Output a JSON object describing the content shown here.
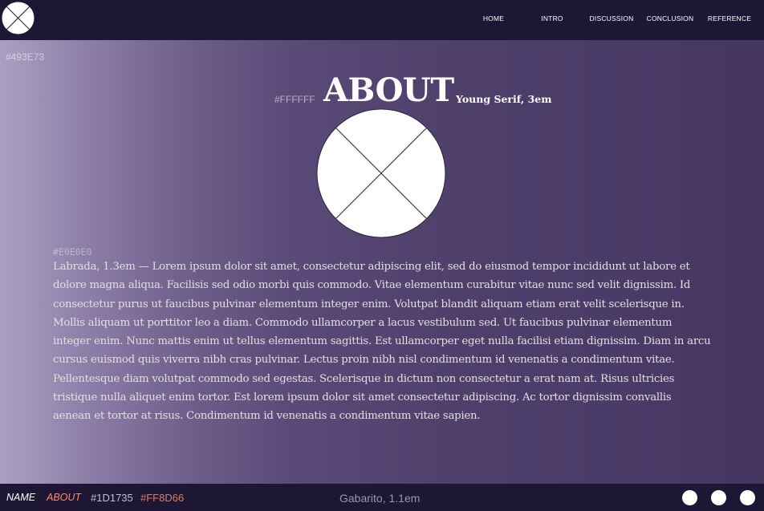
{
  "header": {
    "nav": [
      {
        "label": "HOME",
        "key": "home"
      },
      {
        "label": "INTRO",
        "key": "intro"
      },
      {
        "label": "DISCUSSION",
        "key": "discussion"
      },
      {
        "label": "CONCLUSION",
        "key": "conclusion"
      },
      {
        "label": "REFERENCE",
        "key": "reference"
      }
    ]
  },
  "main": {
    "bg_color_note": "#493E73",
    "title_color_note": "#FFFFFF",
    "title": "ABOUT",
    "title_font_note": "Young Serif, 3em",
    "body_color_note": "#E0E0E0",
    "body_text": "Labrada, 1.3em —  Lorem ipsum dolor sit amet, consectetur adipiscing elit, sed do eiusmod tempor incididunt ut labore et dolore magna aliqua. Facilisis sed odio morbi quis commodo. Vitae elementum curabitur vitae nunc sed velit dignissim. Id consectetur purus ut faucibus pulvinar elementum integer enim. Volutpat blandit aliquam etiam erat velit scelerisque in. Mollis aliquam ut porttitor leo a diam. Commodo ullamcorper a lacus vestibulum sed. Ut faucibus pulvinar elementum integer enim. Nunc mattis enim ut tellus elementum sagittis. Est ullamcorper eget nulla facilisi etiam dignissim. Diam in arcu cursus euismod quis viverra nibh cras pulvinar. Lectus proin nibh nisl condimentum id venenatis a condimentum vitae. Pellentesque diam volutpat commodo sed egestas. Scelerisque in dictum non consectetur a erat nam at. Risus ultricies tristique nulla aliquet enim tortor. Est lorem ipsum dolor sit amet consectetur adipiscing. Ac tortor dignissim convallis aenean et tortor at risus. Condimentum id venenatis a condimentum vitae sapien."
  },
  "footer": {
    "name_label": "NAME",
    "about_label": "ABOUT",
    "color1": "#1D1735",
    "color2": "#FF8D66",
    "font_note": "Gabarito, 1.1em"
  },
  "colors": {
    "header_bg": "#1D1735",
    "accent": "#FF8D66",
    "text": "#FFFFFF",
    "body_text": "#E0E0E0"
  }
}
